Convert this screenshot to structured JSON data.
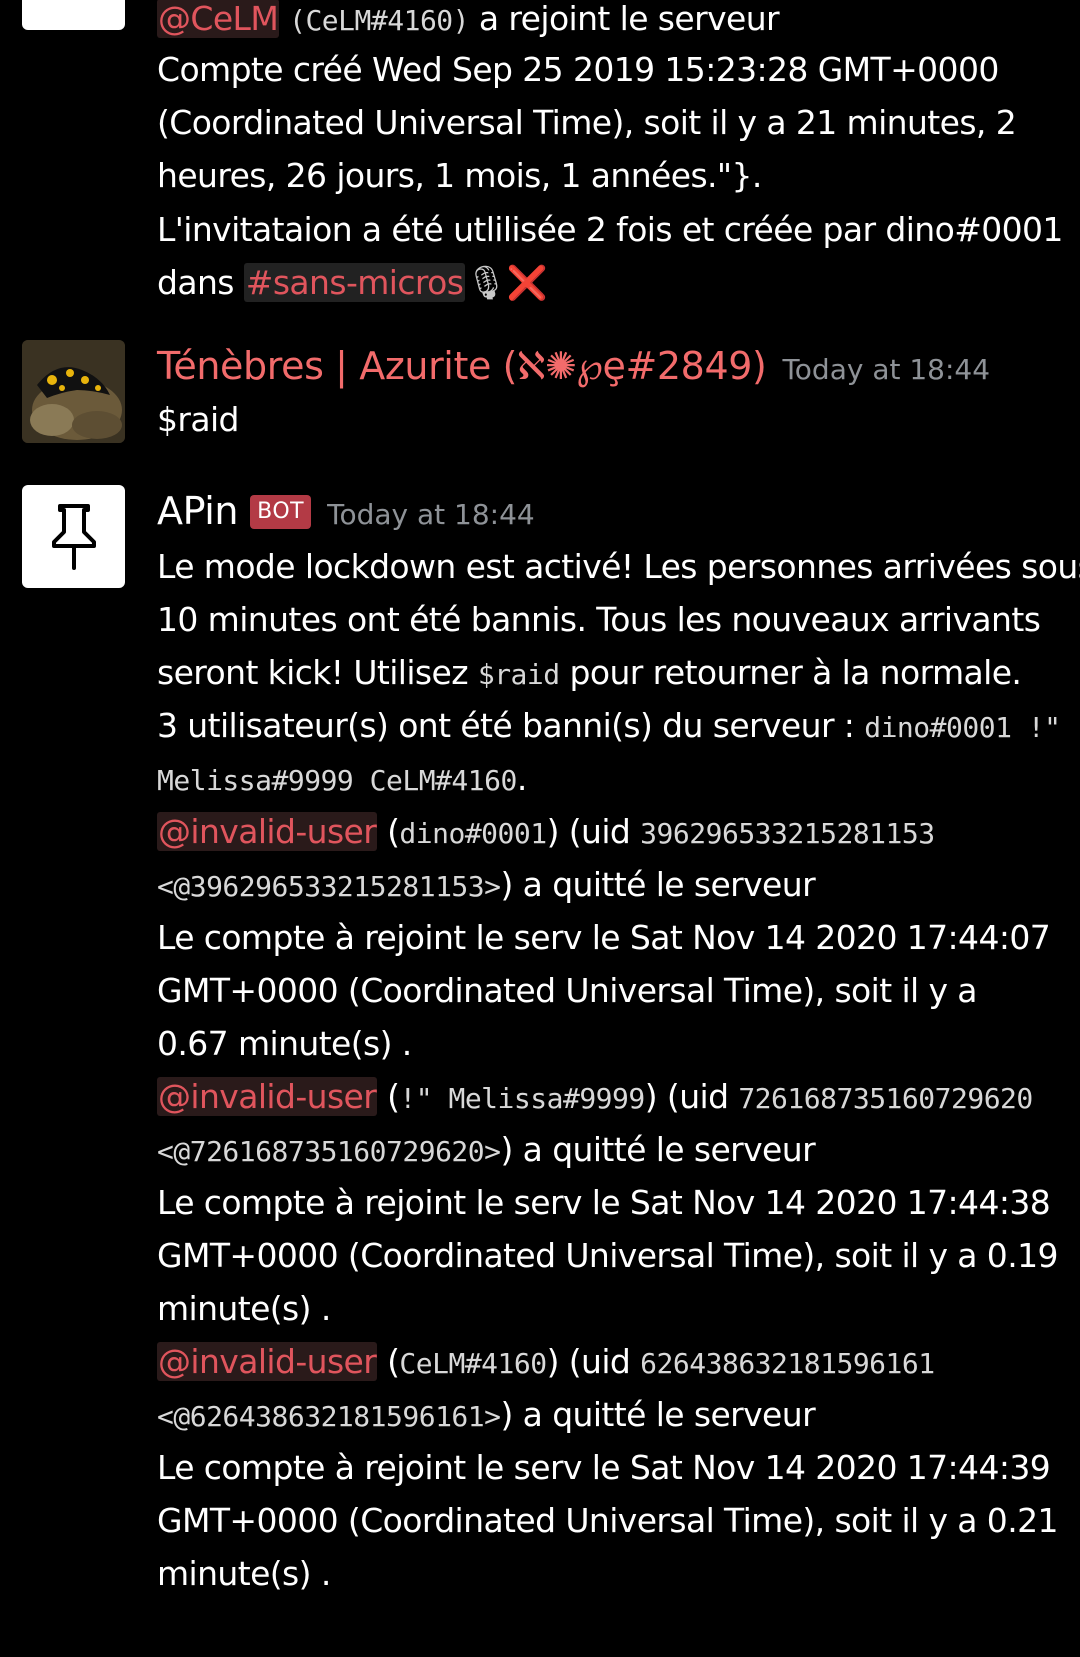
{
  "prev_message": {
    "line0_mention": "@CeLM",
    "line0_mono": "(CeLM#4160)",
    "line0_rest": " a rejoint le serveur",
    "line1": "Compte créé Wed Sep 25 2019 15:23:28 GMT+0000",
    "line2": "(Coordinated Universal Time), soit il y a 21  minutes, 2",
    "line3": "heures, 26 jours, 1 mois, 1 années.\"}.",
    "line4": "L'invitataion a été utlilisée 2 fois et créée par dino#0001",
    "line5_prefix": "dans ",
    "line5_channel": "#sans-micros",
    "line5_mic": "🎙",
    "line5_x": "❌"
  },
  "msg_tenebres": {
    "author": "Ténèbres | Azurite (ℵ✺℘ȩ#2849)",
    "author_color": "#f26b6b",
    "timestamp": "Today at 18:44",
    "text": "$raid"
  },
  "msg_apin": {
    "author": "APin",
    "bot_tag": "BOT",
    "timestamp": "Today at 18:44",
    "l1": "Le mode lockdown est activé! Les personnes arrivées sous",
    "l2": "10 minutes ont été bannis. Tous les nouveaux arrivants",
    "l3a": "seront kick! Utilisez ",
    "l3code": "$raid",
    "l3b": " pour retourner à la normale.",
    "l4a": "3 utilisateur(s) ont été banni(s) du serveur : ",
    "l4code": "dino#0001 !\"",
    "l5code": "Melissa#9999 CeLM#4160",
    "l5end": ".",
    "e1_mention": "@invalid-user",
    "e1_a": " (",
    "e1_name": "dino#0001",
    "e1_b": ") (uid ",
    "e1_uid": "396296533215281153",
    "e1_uid2": "<@396296533215281153>",
    "e1_left": ") a quitté le serveur",
    "e1_j1": "Le compte à rejoint le serv le Sat Nov 14 2020 17:44:07",
    "e1_j2": "GMT+0000 (Coordinated Universal Time), soit il y a",
    "e1_j3": "0.67 minute(s) .",
    "e2_mention": "@invalid-user",
    "e2_a": " (",
    "e2_name": "!\" Melissa#9999",
    "e2_b": ") (uid ",
    "e2_uid": "726168735160729620",
    "e2_uid2": "<@726168735160729620>",
    "e2_left": ") a quitté le serveur",
    "e2_j1": "Le compte à rejoint le serv le Sat Nov 14 2020 17:44:38",
    "e2_j2": "GMT+0000 (Coordinated Universal Time), soit il y a 0.19",
    "e2_j3": "minute(s) .",
    "e3_mention": "@invalid-user",
    "e3_a": " (",
    "e3_name": "CeLM#4160",
    "e3_b": ") (uid ",
    "e3_uid": "626438632181596161",
    "e3_uid2": "<@626438632181596161>",
    "e3_left": ") a quitté le serveur",
    "e3_j1": "Le compte à rejoint le serv le Sat Nov 14 2020 17:44:39",
    "e3_j2": "GMT+0000 (Coordinated Universal Time), soit il y a 0.21",
    "e3_j3": "minute(s) ."
  }
}
